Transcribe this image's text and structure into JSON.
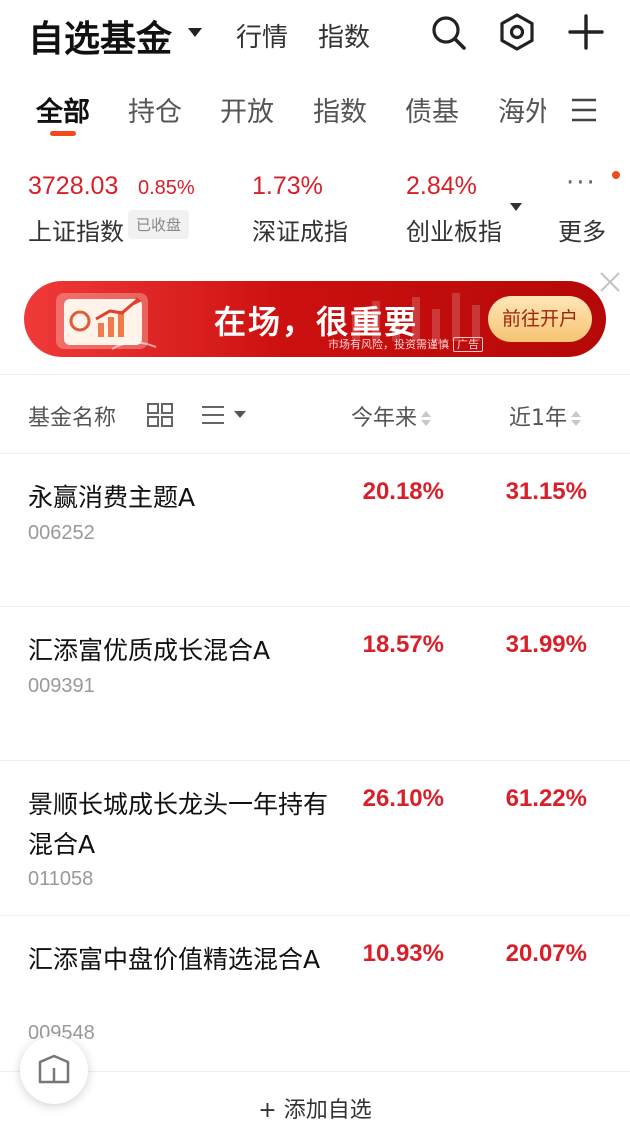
{
  "header": {
    "title": "自选基金",
    "nav": [
      "行情",
      "指数"
    ],
    "icons": [
      "search-icon",
      "settings-hex-icon",
      "plus-icon"
    ]
  },
  "tabs": {
    "items": [
      "全部",
      "持仓",
      "开放",
      "指数",
      "债基",
      "海外"
    ],
    "active": "全部",
    "more_icon": "menu-lines-icon"
  },
  "indices": [
    {
      "value": "3728.03",
      "change": "0.85%",
      "name": "上证指数",
      "badge": "已收盘"
    },
    {
      "value": "1.73%",
      "name": "深证成指"
    },
    {
      "value": "2.84%",
      "name": "创业板指"
    }
  ],
  "indices_more": {
    "dots": "···",
    "label": "更多"
  },
  "banner": {
    "text": "在场，很重要",
    "button": "前往开户",
    "disclaimer": "市场有风险，投资需谨慎",
    "ad": "广告"
  },
  "list_header": {
    "name": "基金名称",
    "col1": "今年来",
    "col2": "近1年"
  },
  "funds": [
    {
      "name": "永赢消费主题A",
      "code": "006252",
      "ytd": "20.18%",
      "one_year": "31.15%"
    },
    {
      "name": "汇添富优质成长混合A",
      "code": "009391",
      "ytd": "18.57%",
      "one_year": "31.99%"
    },
    {
      "name": "景顺长城成长龙头一年持有混合A",
      "code": "011058",
      "ytd": "26.10%",
      "one_year": "61.22%"
    },
    {
      "name": "汇添富中盘价值精选混合A",
      "code": "009548",
      "ytd": "10.93%",
      "one_year": "20.07%"
    }
  ],
  "footer": {
    "add_label": "+ 添加自选"
  },
  "colors": {
    "up_red": "#d8202a",
    "accent_orange": "#f04a1e",
    "banner_red": "#cc1010"
  }
}
